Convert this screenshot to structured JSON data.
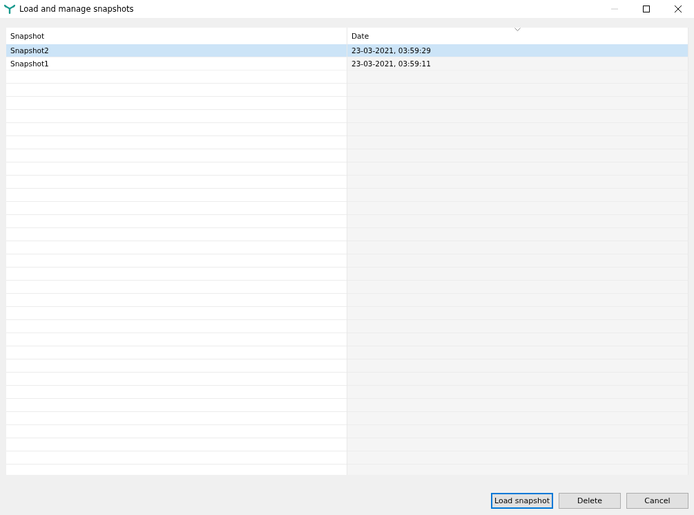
{
  "window": {
    "title": "Load and manage snapshots",
    "minimize_disabled": true
  },
  "table": {
    "columns": [
      {
        "label": "Snapshot",
        "sorted": false
      },
      {
        "label": "Date",
        "sorted": true
      }
    ],
    "rows": [
      {
        "cells": [
          "Snapshot2",
          "23-03-2021, 03:59:29"
        ],
        "selected": true
      },
      {
        "cells": [
          "Snapshot1",
          "23-03-2021, 03:59:11"
        ],
        "selected": false
      }
    ]
  },
  "buttons": [
    {
      "label": "Load snapshot",
      "default": true
    },
    {
      "label": "Delete",
      "default": false
    },
    {
      "label": "Cancel",
      "default": false
    }
  ]
}
